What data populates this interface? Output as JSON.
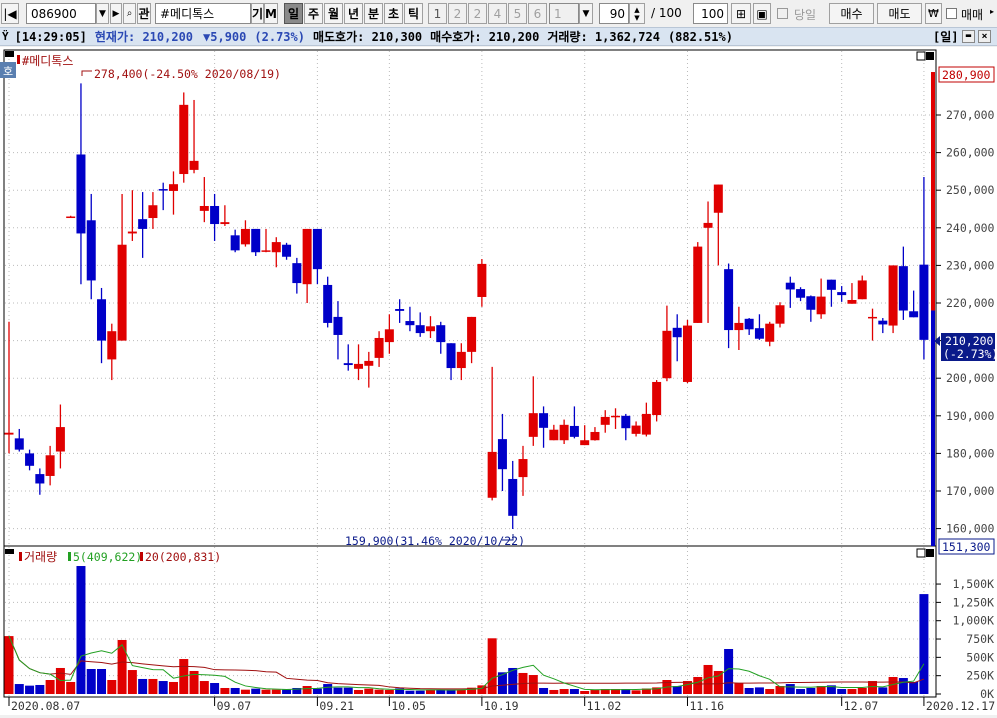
{
  "toolbar": {
    "code": "086900",
    "name": "#메디톡스",
    "gwan": "관",
    "gi": "기",
    "m": "M",
    "periods": [
      "일",
      "주",
      "월",
      "년",
      "분",
      "초",
      "틱"
    ],
    "active_period": "일",
    "numbers": [
      "1",
      "2",
      "2",
      "4",
      "5",
      "6"
    ],
    "combo_value": "1",
    "count_value": "90",
    "count_total": "/ 100",
    "count_input": "100",
    "today_label": "당일",
    "buy_label": "매수",
    "sell_label": "매도",
    "won_label": "₩",
    "trade_label": "매매"
  },
  "info": {
    "time": "[14:29:05]",
    "price_label": "현재가: 210,200",
    "change": "▼5,900",
    "change_pct": "(2.73%)",
    "ask": "매도호가: 210,300",
    "bid": "매수호가: 210,200",
    "volume": "거래량: 1,362,724",
    "volume_pct": "(882.51%)",
    "period_tag": "[일]"
  },
  "chart_data": {
    "type": "candlestick",
    "title": "#메디톡스",
    "side_tag": "호",
    "price_unit": "thousand KRW",
    "ohlc": [
      [
        185,
        215,
        180,
        185.5
      ],
      [
        184,
        186.5,
        180.5,
        181
      ],
      [
        180,
        181,
        175.5,
        176.7
      ],
      [
        174.5,
        176,
        169,
        172
      ],
      [
        174,
        182,
        171.5,
        179.5
      ],
      [
        180.5,
        193,
        176,
        187
      ],
      [
        243,
        243.2,
        243,
        243
      ],
      [
        259.5,
        278.4,
        225,
        238.5
      ],
      [
        242,
        249,
        221,
        226
      ],
      [
        221,
        224,
        204,
        210
      ],
      [
        205,
        214.5,
        199.5,
        212.5
      ],
      [
        210,
        249,
        210,
        235.5
      ],
      [
        238.5,
        250,
        236.5,
        239
      ],
      [
        242.3,
        249.5,
        232,
        239.7
      ],
      [
        242.6,
        249.5,
        239.7,
        246
      ],
      [
        250.3,
        252,
        244.7,
        250
      ],
      [
        249.8,
        255,
        243.5,
        251.6
      ],
      [
        254.3,
        276,
        252,
        272.7
      ],
      [
        255.4,
        274,
        254.5,
        257.8
      ],
      [
        244.5,
        253.5,
        241.5,
        245.8
      ],
      [
        245.8,
        249,
        236.5,
        241
      ],
      [
        241,
        246,
        240.5,
        241.5
      ],
      [
        238,
        239.5,
        233.5,
        234
      ],
      [
        235.6,
        242,
        235,
        239.7
      ],
      [
        239.7,
        239.7,
        232.5,
        233.5
      ],
      [
        233.7,
        239.7,
        233.5,
        234
      ],
      [
        233.5,
        237.5,
        229.5,
        236.2
      ],
      [
        235.5,
        236,
        231.5,
        232.3
      ],
      [
        230.6,
        232,
        222.5,
        225.3
      ],
      [
        225,
        239.7,
        220,
        239.7
      ],
      [
        239.7,
        239.7,
        225,
        229
      ],
      [
        224.8,
        227,
        213.5,
        214.7
      ],
      [
        216.3,
        220.5,
        205,
        211.5
      ],
      [
        204,
        209,
        202,
        203.5
      ],
      [
        202.5,
        209,
        199.5,
        203.8
      ],
      [
        203.3,
        207,
        197.5,
        204.6
      ],
      [
        205.4,
        212.5,
        203,
        210.7
      ],
      [
        209.6,
        217,
        206.5,
        213
      ],
      [
        218.4,
        221,
        214.7,
        217.9
      ],
      [
        215.2,
        219,
        212.5,
        214.1
      ],
      [
        214.1,
        217.5,
        211,
        212
      ],
      [
        212.5,
        216.5,
        210.7,
        213.8
      ],
      [
        214.1,
        215,
        206.5,
        209.6
      ],
      [
        209.3,
        209.3,
        199.5,
        202.7
      ],
      [
        202.7,
        209.3,
        199.5,
        207
      ],
      [
        207,
        216.3,
        204,
        216.3
      ],
      [
        221.6,
        231.7,
        219,
        230.4
      ],
      [
        168.2,
        203,
        167.5,
        180.4
      ],
      [
        183.8,
        190.5,
        170,
        175.8
      ],
      [
        173.2,
        178,
        159.9,
        163.4
      ],
      [
        173.7,
        182,
        168.7,
        178.5
      ],
      [
        184.4,
        200.5,
        182,
        190.7
      ],
      [
        190.7,
        192.5,
        181.5,
        186.8
      ],
      [
        183.5,
        187.6,
        183.5,
        186.3
      ],
      [
        183.5,
        189,
        182.5,
        187.6
      ],
      [
        187.3,
        192.5,
        184,
        184.4
      ],
      [
        182.2,
        187.5,
        182.2,
        183.5
      ],
      [
        183.5,
        187,
        183.4,
        185.7
      ],
      [
        187.6,
        191.5,
        185.5,
        189.7
      ],
      [
        189.8,
        192,
        186.5,
        190
      ],
      [
        190,
        190.5,
        183.5,
        186.7
      ],
      [
        185.2,
        188.5,
        184.5,
        187.4
      ],
      [
        185,
        193.5,
        184.5,
        190.5
      ],
      [
        190.2,
        199.5,
        188.5,
        199
      ],
      [
        200,
        219.3,
        199.2,
        212.6
      ],
      [
        213.4,
        217,
        204.5,
        210.9
      ],
      [
        199,
        215.5,
        198.7,
        214
      ],
      [
        214.7,
        236.2,
        214.7,
        235
      ],
      [
        240,
        247,
        214.7,
        241.3
      ],
      [
        244,
        251.5,
        230,
        251.5
      ],
      [
        229,
        230.5,
        208,
        212.8
      ],
      [
        212.8,
        219,
        207.5,
        214.7
      ],
      [
        215.8,
        216,
        211.5,
        213
      ],
      [
        213.3,
        217,
        210.2,
        210.5
      ],
      [
        209.7,
        215,
        208.5,
        214.5
      ],
      [
        214.5,
        220.2,
        213.5,
        219.4
      ],
      [
        225.4,
        227,
        218.7,
        223.6
      ],
      [
        223.7,
        224.2,
        220.5,
        221.4
      ],
      [
        221.8,
        222,
        215,
        218.2
      ],
      [
        217,
        226.5,
        215.8,
        221.7
      ],
      [
        226.2,
        226.2,
        219,
        223.5
      ],
      [
        222.9,
        224.5,
        220.3,
        222.1
      ],
      [
        219.8,
        225.3,
        219.8,
        220.8
      ],
      [
        221,
        227.3,
        221,
        226
      ],
      [
        216.2,
        218.5,
        210,
        216.3
      ],
      [
        215.3,
        216,
        212,
        214.3
      ],
      [
        214,
        230,
        212,
        230
      ],
      [
        229.8,
        235,
        215.5,
        218
      ],
      [
        217.8,
        223.3,
        216.2,
        216.2
      ],
      [
        230.2,
        253.5,
        205,
        210.2
      ]
    ],
    "volume_k": [
      790,
      136,
      114,
      123,
      191,
      355,
      164,
      1746,
      341,
      341,
      191,
      737,
      327,
      205,
      205,
      177,
      164,
      477,
      314,
      177,
      150,
      82,
      82,
      59,
      73,
      59,
      59,
      59,
      82,
      109,
      73,
      136,
      86,
      86,
      55,
      73,
      59,
      55,
      77,
      45,
      45,
      59,
      59,
      59,
      59,
      86,
      118,
      760,
      296,
      355,
      287,
      259,
      82,
      55,
      68,
      68,
      41,
      55,
      68,
      68,
      68,
      50,
      75,
      90,
      191,
      109,
      177,
      232,
      396,
      314,
      614,
      146,
      82,
      90,
      68,
      109,
      136,
      68,
      82,
      109,
      118,
      68,
      68,
      82,
      177,
      90,
      232,
      218,
      164,
      1363
    ],
    "price_ylim": [
      151.3,
      280.9
    ],
    "price_ticks": [
      "270,000",
      "260,000",
      "250,000",
      "240,000",
      "230,000",
      "220,000",
      "210,000",
      "200,000",
      "190,000",
      "180,000",
      "170,000",
      "160,000"
    ],
    "price_tick_values": [
      270,
      260,
      250,
      240,
      230,
      220,
      210,
      200,
      190,
      180,
      170,
      160
    ],
    "high_label": "278,400(-24.50% 2020/08/19)",
    "low_label": "159,900(31.46% 2020/10/22)",
    "axis_top": "280,900",
    "axis_bottom": "151,300",
    "current_price": "210,200",
    "current_pct": "(-2.73%)",
    "volume_title": "거래량",
    "ma5_label": "5(409,622)",
    "ma20_label": "20(200,831)",
    "volume_ticks": [
      "1,500K",
      "1,250K",
      "1,000K",
      "750K",
      "500K",
      "250K",
      "0K"
    ],
    "volume_tick_values": [
      1500,
      1250,
      1000,
      750,
      500,
      250,
      0
    ],
    "x_labels": [
      {
        "i": 0,
        "t": "2020.08.07"
      },
      {
        "i": 20,
        "t": "09.07"
      },
      {
        "i": 30,
        "t": "09.21"
      },
      {
        "i": 37,
        "t": "10.05"
      },
      {
        "i": 46,
        "t": "10.19"
      },
      {
        "i": 56,
        "t": "11.02"
      },
      {
        "i": 66,
        "t": "11.16"
      },
      {
        "i": 81,
        "t": "12.07"
      },
      {
        "i": 89,
        "t": "2020.12.17"
      }
    ],
    "colors": {
      "up": "#e00000",
      "down": "#0000c8",
      "ma5": "#22a022",
      "ma20": "#a01010",
      "navy": "#0a1a8a"
    }
  }
}
